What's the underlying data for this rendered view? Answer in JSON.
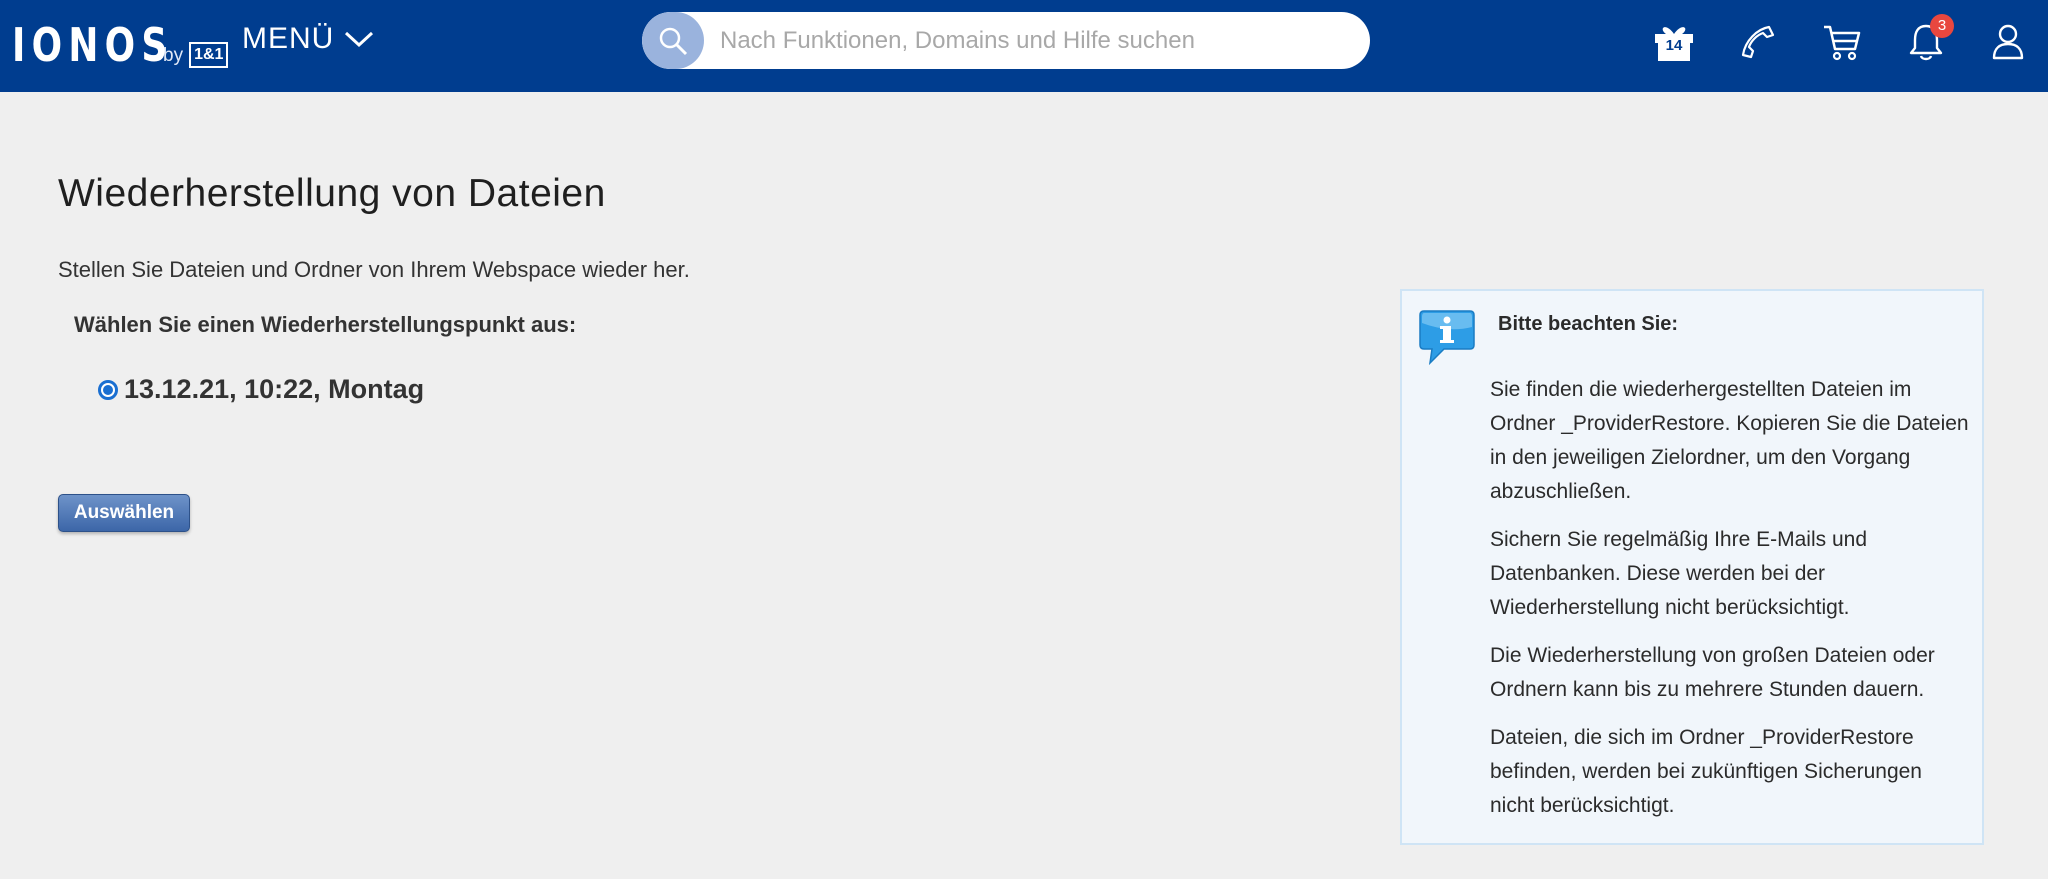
{
  "header": {
    "logo_word": "IONOS",
    "logo_by": "by",
    "logo_brand": "1&1",
    "menu_label": "MENÜ",
    "search_placeholder": "Nach Funktionen, Domains und Hilfe suchen",
    "gift_days": "14",
    "notification_count": "3",
    "icons": [
      "search-icon",
      "gift-icon",
      "phone-icon",
      "cart-icon",
      "bell-icon",
      "user-icon"
    ],
    "bg_color": "#003d8f"
  },
  "main": {
    "title": "Wiederherstellung von Dateien",
    "subtitle": "Stellen Sie Dateien und Ordner von Ihrem Webspace wieder her.",
    "choose_label": "Wählen Sie einen Wiederherstellungspunkt aus:",
    "restore_points": [
      {
        "label": "13.12.21, 10:22, Montag",
        "selected": true
      }
    ],
    "select_button": "Auswählen"
  },
  "note": {
    "title": "Bitte beachten Sie:",
    "paragraphs": [
      "Sie finden die wiederhergestellten Dateien im Ordner _ProviderRestore. Kopieren Sie die Dateien in den jeweiligen Zielordner, um den Vorgang abzuschließen.",
      "Sichern Sie regelmäßig Ihre E-Mails und Datenbanken. Diese werden bei der Wiederherstellung nicht berücksichtigt.",
      "Die Wiederherstellung von großen Dateien oder Ordnern kann bis zu mehrere Stunden dauern.",
      "Dateien, die sich im Ordner _ProviderRestore befinden, werden bei zukünftigen Sicherungen nicht berücksichtigt."
    ]
  }
}
